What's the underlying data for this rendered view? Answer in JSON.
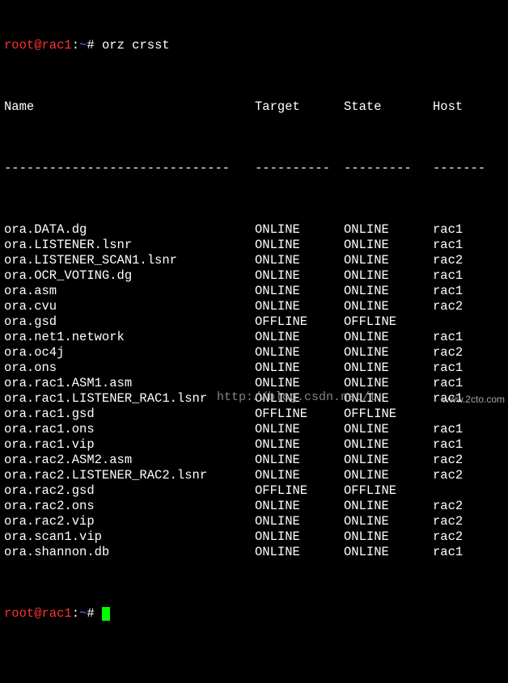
{
  "prompt": {
    "user": "root@rac1",
    "sep": ":",
    "path": "~",
    "symbol": "#",
    "command": "orz crsst"
  },
  "headers": {
    "name": "Name",
    "target": "Target",
    "state": "State",
    "host": "Host"
  },
  "rules": {
    "name": "------------------------------",
    "target": "----------",
    "state": "---------",
    "host": "-------"
  },
  "rows": [
    {
      "name": "ora.DATA.dg",
      "target": "ONLINE",
      "state": "ONLINE",
      "host": "rac1"
    },
    {
      "name": "ora.LISTENER.lsnr",
      "target": "ONLINE",
      "state": "ONLINE",
      "host": "rac1"
    },
    {
      "name": "ora.LISTENER_SCAN1.lsnr",
      "target": "ONLINE",
      "state": "ONLINE",
      "host": "rac2"
    },
    {
      "name": "ora.OCR_VOTING.dg",
      "target": "ONLINE",
      "state": "ONLINE",
      "host": "rac1"
    },
    {
      "name": "ora.asm",
      "target": "ONLINE",
      "state": "ONLINE",
      "host": "rac1"
    },
    {
      "name": "ora.cvu",
      "target": "ONLINE",
      "state": "ONLINE",
      "host": "rac2"
    },
    {
      "name": "ora.gsd",
      "target": "OFFLINE",
      "state": "OFFLINE",
      "host": ""
    },
    {
      "name": "ora.net1.network",
      "target": "ONLINE",
      "state": "ONLINE",
      "host": "rac1"
    },
    {
      "name": "ora.oc4j",
      "target": "ONLINE",
      "state": "ONLINE",
      "host": "rac2"
    },
    {
      "name": "ora.ons",
      "target": "ONLINE",
      "state": "ONLINE",
      "host": "rac1"
    },
    {
      "name": "ora.rac1.ASM1.asm",
      "target": "ONLINE",
      "state": "ONLINE",
      "host": "rac1"
    },
    {
      "name": "ora.rac1.LISTENER_RAC1.lsnr",
      "target": "ONLINE",
      "state": "ONLINE",
      "host": "rac1"
    },
    {
      "name": "ora.rac1.gsd",
      "target": "OFFLINE",
      "state": "OFFLINE",
      "host": ""
    },
    {
      "name": "ora.rac1.ons",
      "target": "ONLINE",
      "state": "ONLINE",
      "host": "rac1"
    },
    {
      "name": "ora.rac1.vip",
      "target": "ONLINE",
      "state": "ONLINE",
      "host": "rac1"
    },
    {
      "name": "ora.rac2.ASM2.asm",
      "target": "ONLINE",
      "state": "ONLINE",
      "host": "rac2"
    },
    {
      "name": "ora.rac2.LISTENER_RAC2.lsnr",
      "target": "ONLINE",
      "state": "ONLINE",
      "host": "rac2"
    },
    {
      "name": "ora.rac2.gsd",
      "target": "OFFLINE",
      "state": "OFFLINE",
      "host": ""
    },
    {
      "name": "ora.rac2.ons",
      "target": "ONLINE",
      "state": "ONLINE",
      "host": "rac2"
    },
    {
      "name": "ora.rac2.vip",
      "target": "ONLINE",
      "state": "ONLINE",
      "host": "rac2"
    },
    {
      "name": "ora.scan1.vip",
      "target": "ONLINE",
      "state": "ONLINE",
      "host": "rac2"
    },
    {
      "name": "ora.shannon.db",
      "target": "ONLINE",
      "state": "ONLINE",
      "host": "rac1"
    }
  ],
  "watermark": "http://blog.csdn.net/t",
  "brand": "www.2cto.com",
  "colors": {
    "background": "#000000",
    "text": "#ffffff",
    "prompt_user": "#ff3333",
    "prompt_path": "#4f7fff",
    "cursor": "#00ff00"
  }
}
